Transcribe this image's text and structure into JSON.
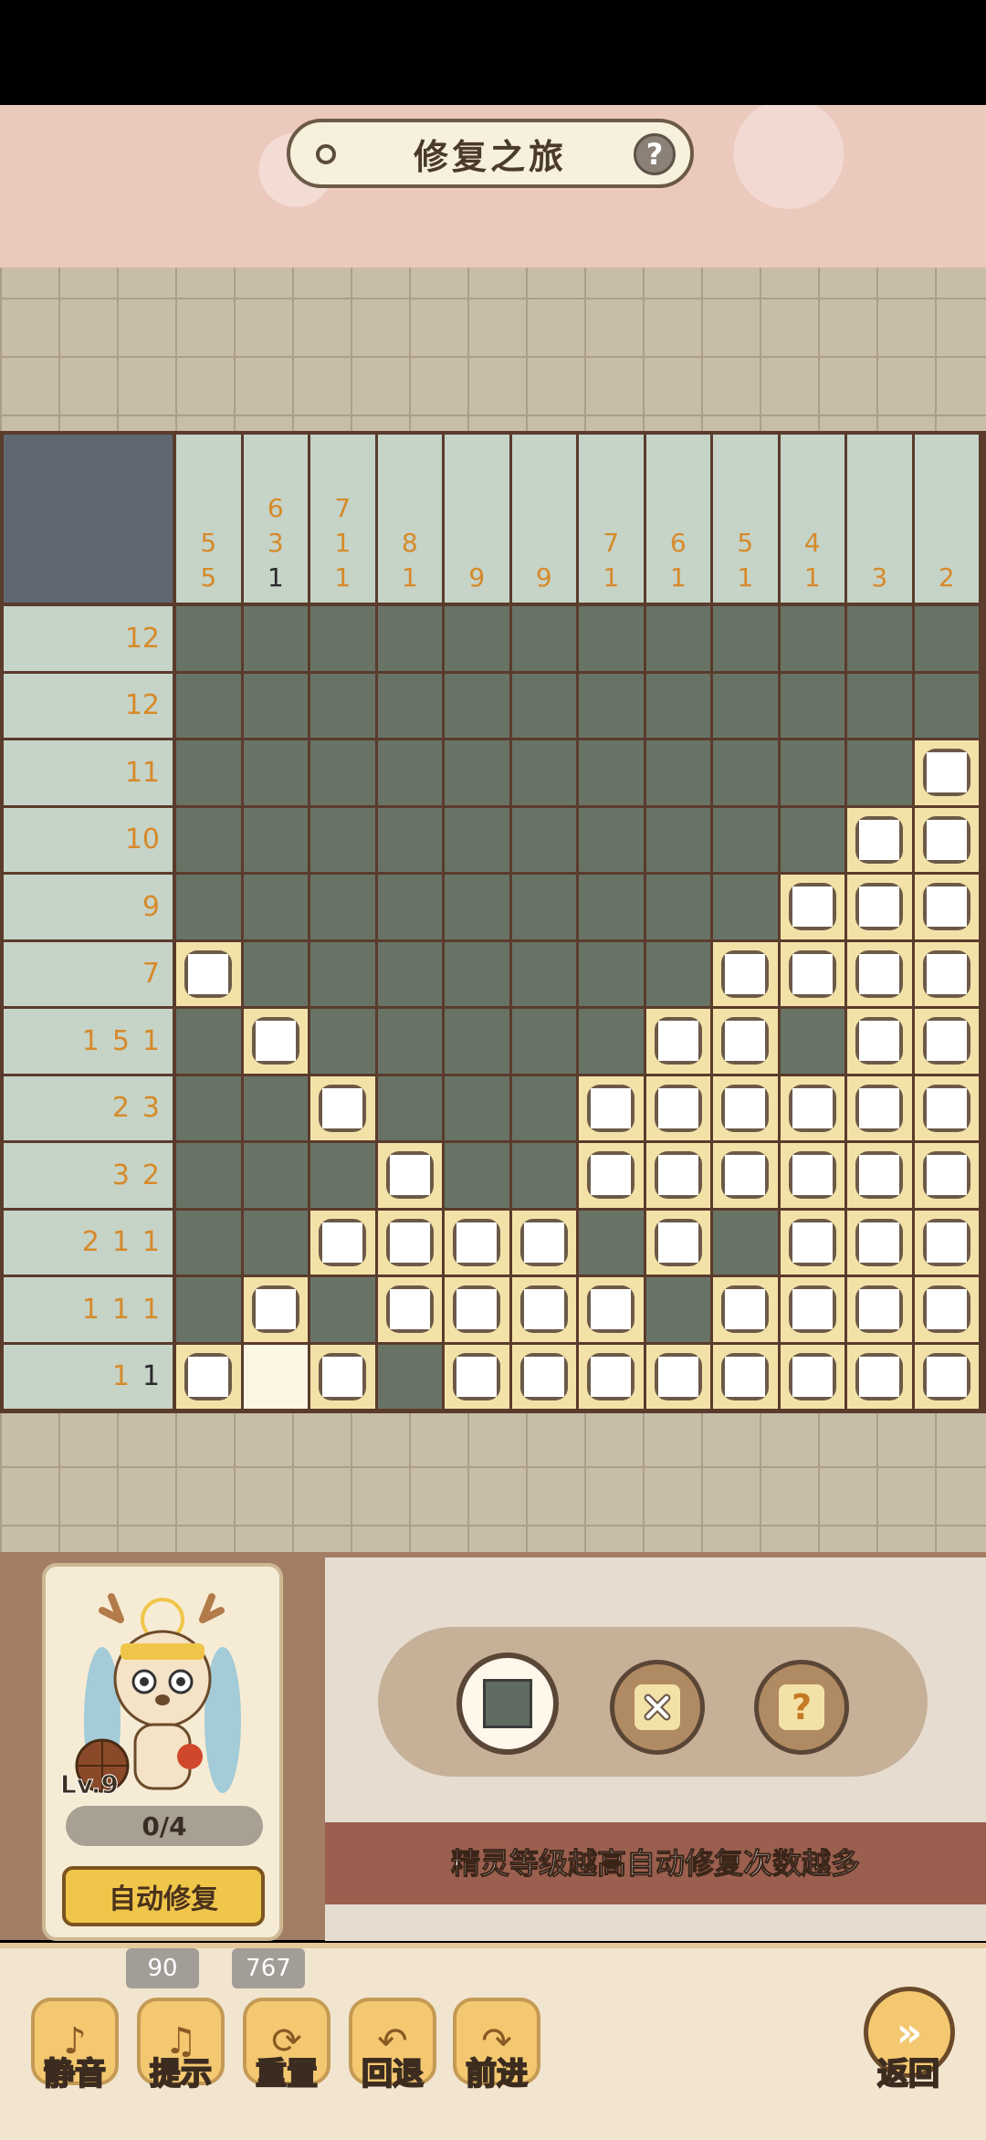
{
  "header": {
    "title": "修复之旅",
    "help_glyph": "?"
  },
  "puzzle": {
    "col_clues": [
      [
        "5",
        "5"
      ],
      [
        "6",
        "3",
        "1"
      ],
      [
        "7",
        "1",
        "1"
      ],
      [
        "8",
        "1"
      ],
      [
        "9"
      ],
      [
        "9"
      ],
      [
        "7",
        "1"
      ],
      [
        "6",
        "1"
      ],
      [
        "5",
        "1"
      ],
      [
        "4",
        "1"
      ],
      [
        "3"
      ],
      [
        "2"
      ]
    ],
    "col_clue_done": [
      [
        false,
        false
      ],
      [
        false,
        false,
        true
      ],
      [
        false,
        false,
        false
      ],
      [
        false,
        false
      ],
      [
        false
      ],
      [
        false
      ],
      [
        false,
        false
      ],
      [
        false,
        false
      ],
      [
        false,
        false
      ],
      [
        false,
        false
      ],
      [
        false
      ],
      [
        false
      ]
    ],
    "row_clues": [
      [
        "12"
      ],
      [
        "12"
      ],
      [
        "11"
      ],
      [
        "10"
      ],
      [
        "9"
      ],
      [
        "7"
      ],
      [
        "1",
        "5",
        "1"
      ],
      [
        "2",
        "3"
      ],
      [
        "3",
        "2"
      ],
      [
        "2",
        "1",
        "1"
      ],
      [
        "1",
        "1",
        "1"
      ],
      [
        "1",
        "1"
      ]
    ],
    "row_clue_done": [
      [
        false
      ],
      [
        false
      ],
      [
        false
      ],
      [
        false
      ],
      [
        false
      ],
      [
        false
      ],
      [
        false,
        false,
        false
      ],
      [
        false,
        false
      ],
      [
        false,
        false
      ],
      [
        false,
        false,
        false
      ],
      [
        false,
        false,
        false
      ],
      [
        false,
        true
      ]
    ],
    "grid": [
      "FFFFFFFFFFFF",
      "FFFFFFFFFFFF",
      "FFFFFFFFFFFX",
      "FFFFFFFFFFXX",
      "FFFFFFFFFXXX",
      "XFFFFFFFXXXX",
      "FXFFFFFXXFXX",
      "FFXFFFXXXXXX",
      "FFFXFFXXXXXX",
      "FFXXXXFXFXXX",
      "FXFXXXXFXXXX",
      "XEXFXXXXXXXX"
    ]
  },
  "character": {
    "level": "Lv.9",
    "progress": "0/4",
    "auto_repair_label": "自动修复"
  },
  "tools": {
    "fill": "fill-tool",
    "cross": "cross-tool",
    "unknown_glyph": "?"
  },
  "hint": "精灵等级越高自动修复次数越多",
  "footer": {
    "mute_label": "静音",
    "hint_label": "提示",
    "hint_count": "90",
    "reset_label": "重置",
    "reset_count": "767",
    "undo_label": "回退",
    "redo_label": "前进",
    "back_label": "返回"
  },
  "colors": {
    "filled": "#687365",
    "crossed": "#f3e2a8",
    "empty": "#fbf5e4",
    "clue": "#d68a2a"
  }
}
